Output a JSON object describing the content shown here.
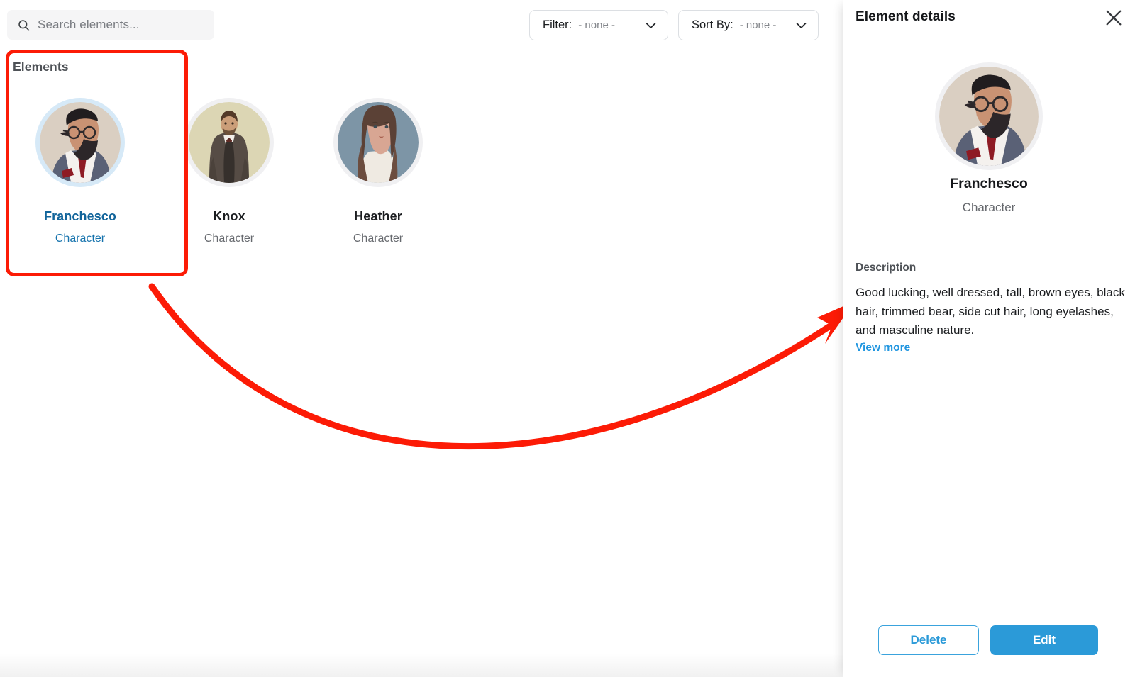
{
  "search": {
    "placeholder": "Search elements...",
    "value": "",
    "icon": "search-icon"
  },
  "toolbar": {
    "filter": {
      "label": "Filter:",
      "value": "- none -",
      "icon": "chevron-down-icon"
    },
    "sort": {
      "label": "Sort By:",
      "value": "- none -",
      "icon": "chevron-down-icon"
    }
  },
  "elements": {
    "section_title": "Elements",
    "items": [
      {
        "name": "Franchesco",
        "type": "Character",
        "selected": true
      },
      {
        "name": "Knox",
        "type": "Character",
        "selected": false
      },
      {
        "name": "Heather",
        "type": "Character",
        "selected": false
      }
    ]
  },
  "details": {
    "title": "Element details",
    "close_icon": "close-icon",
    "name": "Franchesco",
    "type": "Character",
    "description_label": "Description",
    "description": "Good lucking, well dressed, tall, brown eyes, black hair, trimmed bear, side cut hair, long eyelashes, and masculine nature.",
    "view_more_label": "View more",
    "delete_label": "Delete",
    "edit_label": "Edit"
  },
  "colors": {
    "accent_blue": "#2b9ad8",
    "selected_text_blue": "#12659b",
    "annotation_red": "#fc1b06",
    "panel_bg": "#ffffff",
    "search_bg": "#f5f5f6"
  }
}
